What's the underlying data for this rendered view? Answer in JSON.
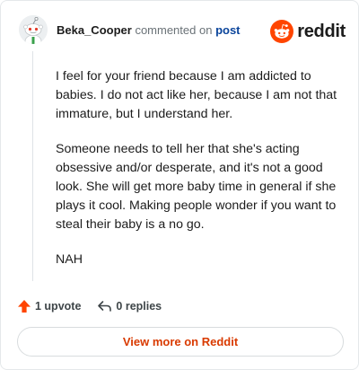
{
  "header": {
    "username": "Beka_Cooper",
    "action_text": "commented on",
    "post_link": "post",
    "logo_text": "reddit"
  },
  "comment": {
    "paragraphs": [
      "I feel for your friend because I am addicted to babies. I do not act like her, because I am not that immature, but I understand her.",
      "Someone needs to tell her that she's acting obsessive and/or desperate, and it's not a good look. She will get more baby time in general if she plays it cool. Making people wonder if you want to steal their baby is a no go.",
      "NAH"
    ]
  },
  "actions": {
    "upvotes": "1 upvote",
    "replies": "0 replies"
  },
  "footer": {
    "view_more": "View more on Reddit"
  },
  "colors": {
    "brand": "#ff4500",
    "link": "#0a449b",
    "view_more_text": "#d93a00"
  }
}
